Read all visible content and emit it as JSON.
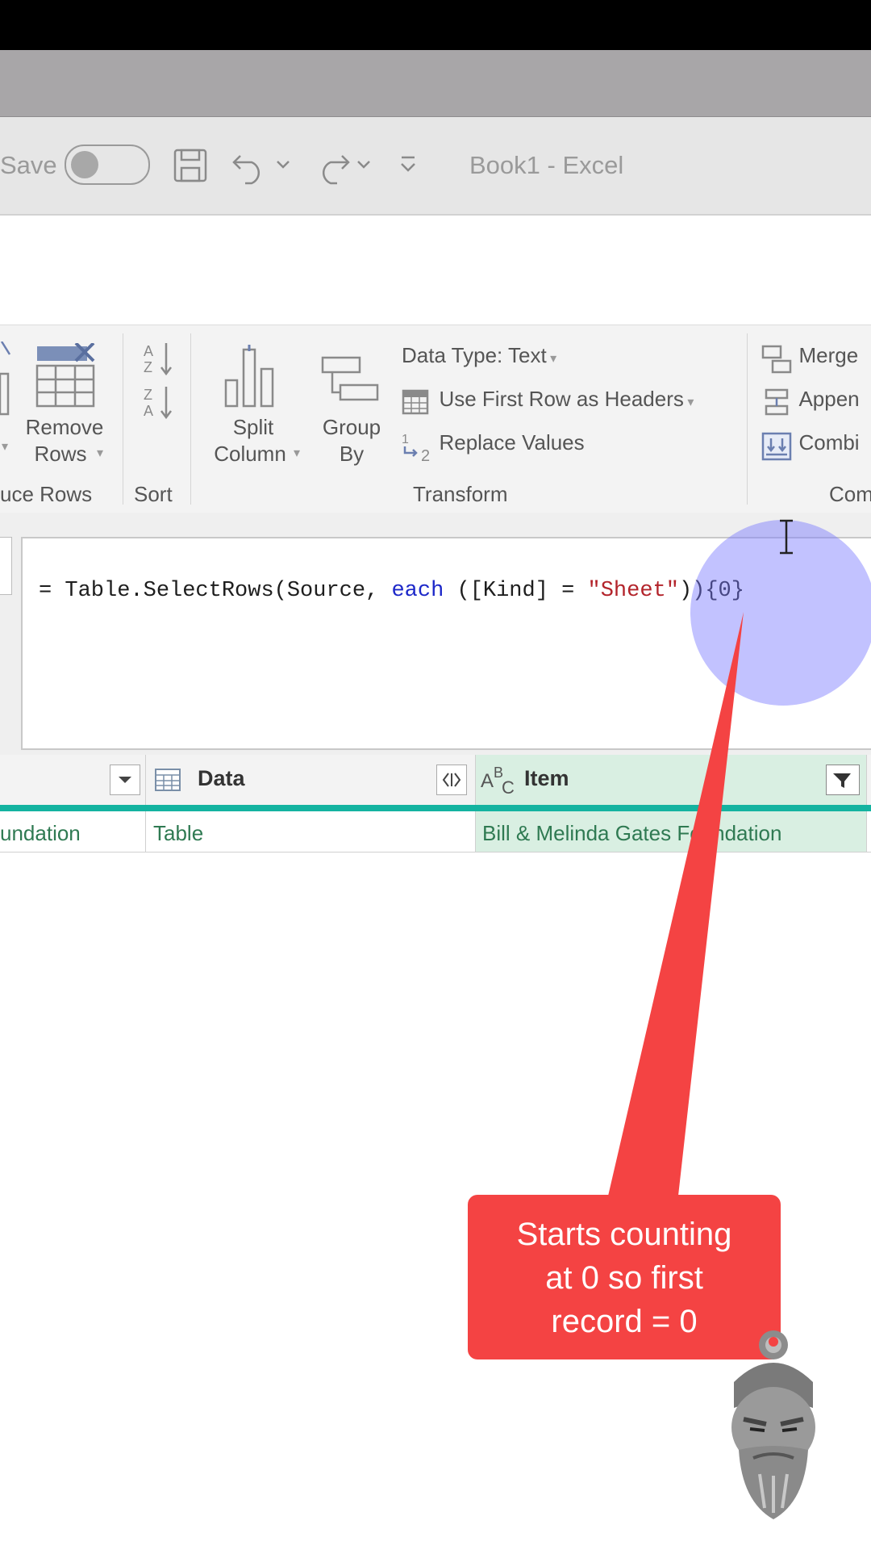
{
  "titlebar": {
    "autosave_label": "Save",
    "window_title": "Book1  -  Excel"
  },
  "ribbon": {
    "remove_rows": {
      "line1": "Remove",
      "line2": "Rows"
    },
    "reduce_rows_group": "uce Rows",
    "sort_group": "Sort",
    "split_column": {
      "line1": "Split",
      "line2": "Column"
    },
    "group_by": {
      "line1": "Group",
      "line2": "By"
    },
    "data_type": "Data Type: Text",
    "use_first_row": "Use First Row as Headers",
    "replace_values": "Replace Values",
    "transform_group": "Transform",
    "merge": "Merge",
    "append": "Appen",
    "combine": "Combi",
    "combine_group": "Com"
  },
  "formula": {
    "prefix": "= Table.SelectRows(Source, ",
    "keyword": "each",
    "middle": " ([Kind] = ",
    "string": "\"Sheet\"",
    "suffix": ")){0}"
  },
  "table": {
    "columns": [
      {
        "label": ""
      },
      {
        "label": "Data"
      },
      {
        "label": "Item"
      }
    ],
    "rows": [
      [
        "undation",
        "Table",
        "Bill & Melinda Gates Foundation"
      ]
    ]
  },
  "callout": {
    "line1": "Starts counting",
    "line2": "at 0 so first",
    "line3": "record = 0",
    "color": "#f44343"
  },
  "colors": {
    "accent_teal": "#14b3a0",
    "item_column_bg": "#d9efe2",
    "keyword_blue": "#1d28c9",
    "string_red": "#b3242b"
  }
}
